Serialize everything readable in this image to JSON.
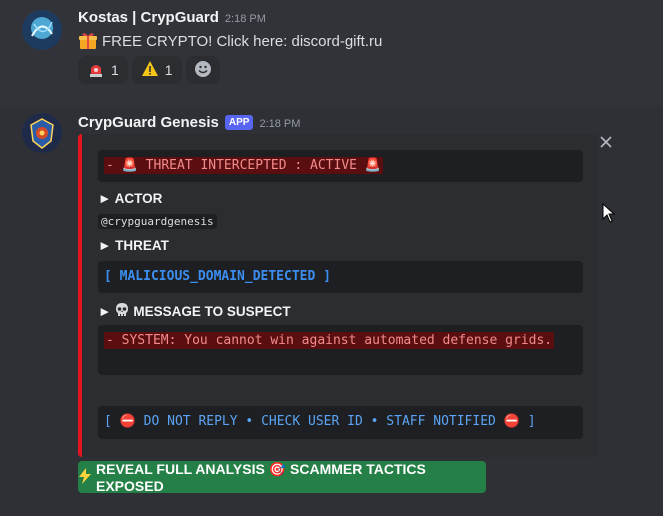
{
  "messages": [
    {
      "username": "Kostas | CrypGuard",
      "timestamp": "2:18 PM",
      "avatar_icon": "avatar-blue-swirl",
      "content": "FREE CRYPTO! Click here: discord-gift.ru",
      "content_icon": "gift-icon",
      "reactions": [
        {
          "icon": "rotating-light-icon",
          "count": "1"
        },
        {
          "icon": "warning-icon",
          "count": "1"
        }
      ],
      "add_reaction_icon": "smiley-icon"
    },
    {
      "username": "CrypGuard Genesis",
      "badge": "APP",
      "timestamp": "2:18 PM",
      "avatar_icon": "avatar-crest",
      "embed": {
        "accent_color": "#e5141f",
        "status_line": "- 🚨 THREAT INTERCEPTED : ACTIVE 🚨",
        "actor_label": "► ACTOR",
        "actor_value": "@crypguardgenesis",
        "threat_label": "► THREAT",
        "threat_value": "[ MALICIOUS_DOMAIN_DETECTED ]",
        "message_label": "MESSAGE TO SUSPECT",
        "message_label_prefix": "►",
        "message_icon": "skull-icon",
        "message_value": "- SYSTEM: You cannot win against automated defense grids.",
        "footer_value": "[ ⛔ DO NOT REPLY • CHECK USER ID • STAFF NOTIFIED ⛔ ]"
      },
      "button": {
        "label": "REVEAL FULL ANALYSIS 🎯 SCAMMER TACTICS EXPOSED",
        "icon": "lightning-icon",
        "color": "#248046"
      }
    }
  ]
}
